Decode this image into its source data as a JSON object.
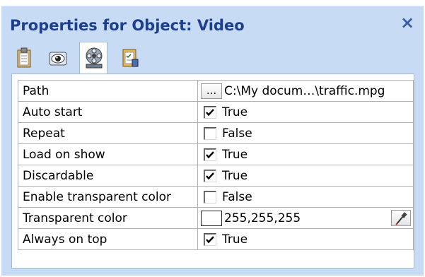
{
  "window": {
    "title": "Properties for Object: Video",
    "close_glyph": "×"
  },
  "tabs": [
    {
      "icon": "clipboard-icon",
      "active": false
    },
    {
      "icon": "eye-icon",
      "active": false
    },
    {
      "icon": "film-reel-icon",
      "active": true
    },
    {
      "icon": "checklist-icon",
      "active": false
    }
  ],
  "properties": [
    {
      "name": "Path",
      "type": "path",
      "button": "...",
      "value": "C:\\My docum…\\traffic.mpg"
    },
    {
      "name": "Auto start",
      "type": "bool",
      "checked": true,
      "value": "True"
    },
    {
      "name": "Repeat",
      "type": "bool",
      "checked": false,
      "value": "False"
    },
    {
      "name": "Load on show",
      "type": "bool",
      "checked": true,
      "value": "True"
    },
    {
      "name": "Discardable",
      "type": "bool",
      "checked": true,
      "value": "True"
    },
    {
      "name": "Enable transparent color",
      "type": "bool",
      "checked": false,
      "value": "False"
    },
    {
      "name": "Transparent color",
      "type": "color",
      "color": "#ffffff",
      "value": "255,255,255"
    },
    {
      "name": "Always on top",
      "type": "bool",
      "checked": true,
      "value": "True"
    }
  ],
  "colors": {
    "panel_bg": "#c8dbf4",
    "title_text": "#1e3f8e"
  }
}
